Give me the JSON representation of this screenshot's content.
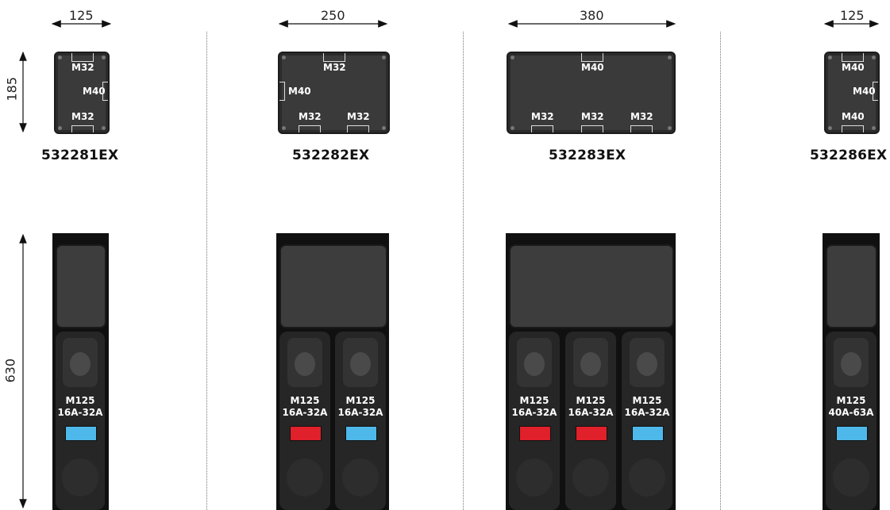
{
  "dimensions": {
    "w1": "125",
    "w2": "250",
    "w3": "380",
    "w4": "125",
    "h_small": "185",
    "h_large": "630"
  },
  "products": [
    {
      "code": "532281EX",
      "glands": [
        "M32",
        "M40",
        "M32"
      ]
    },
    {
      "code": "532282EX",
      "glands": [
        "M32",
        "M40",
        "M32",
        "M32"
      ]
    },
    {
      "code": "532283EX",
      "glands": [
        "M40",
        "M32",
        "M32",
        "M32"
      ]
    },
    {
      "code": "532286EX",
      "glands": [
        "M40",
        "M40",
        "M40"
      ]
    }
  ],
  "sockets": {
    "p1": [
      {
        "model": "M125",
        "rating": "16A-32A",
        "indicator": "blue"
      }
    ],
    "p2": [
      {
        "model": "M125",
        "rating": "16A-32A",
        "indicator": "red"
      },
      {
        "model": "M125",
        "rating": "16A-32A",
        "indicator": "blue"
      }
    ],
    "p3": [
      {
        "model": "M125",
        "rating": "16A-32A",
        "indicator": "red"
      },
      {
        "model": "M125",
        "rating": "16A-32A",
        "indicator": "red"
      },
      {
        "model": "M125",
        "rating": "16A-32A",
        "indicator": "blue"
      }
    ],
    "p4": [
      {
        "model": "M125",
        "rating": "40A-63A",
        "indicator": "blue"
      }
    ]
  },
  "colors": {
    "blue": "#4fb8ea",
    "red": "#e0202a",
    "enclosure": "#3a3a3a",
    "panel": "#101010"
  }
}
